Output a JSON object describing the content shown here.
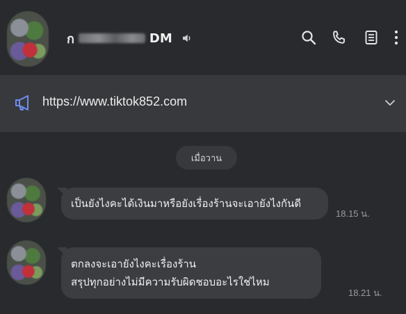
{
  "header": {
    "name_prefix": "ก",
    "name_suffix": "DM",
    "icons": [
      "search-icon",
      "phone-icon",
      "notes-icon",
      "more-icon",
      "speaker-icon"
    ]
  },
  "announcement": {
    "url": "https://www.tiktok852.com",
    "icon": "megaphone-icon"
  },
  "date_separator": "เมื่อวาน",
  "messages": [
    {
      "lines": [
        "เป็นยังไงคะได้เงินมาหรือยังเรื่องร้านจะเอายังไงกันดี"
      ],
      "time": "18.15 น."
    },
    {
      "lines": [
        "ตกลงจะเอายังไงคะเรื่องร้าน",
        "สรุปทุกอย่างไม่มีความรับผิดชอบอะไรใช่ไหม"
      ],
      "time": "18.21 น."
    }
  ],
  "colors": {
    "background": "#292a2d",
    "bar": "#38393c",
    "bubble": "#3c3d41",
    "accent": "#6f8df2"
  }
}
